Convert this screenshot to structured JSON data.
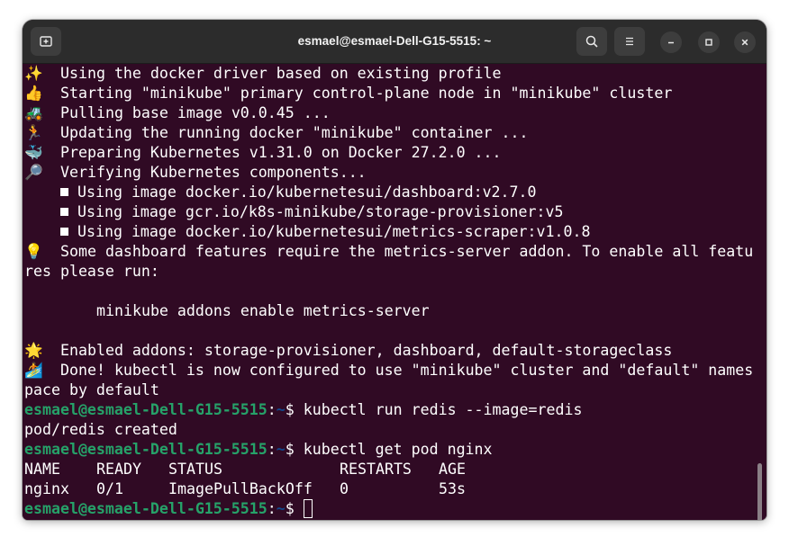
{
  "window": {
    "title": "esmael@esmael-Dell-G15-5515: ~",
    "new_tab_icon": "new-tab-icon",
    "search_icon": "search-icon",
    "menu_icon": "hamburger-menu-icon",
    "minimize_icon": "minimize-icon",
    "maximize_icon": "maximize-icon",
    "close_icon": "close-icon"
  },
  "terminal": {
    "colors": {
      "background": "#300a24",
      "prompt_user": "#26a269",
      "prompt_path": "#12488b",
      "text": "#ffffff"
    },
    "lines": [
      {
        "emoji": "✨",
        "text": "Using the docker driver based on existing profile"
      },
      {
        "emoji": "👍",
        "text": "Starting \"minikube\" primary control-plane node in \"minikube\" cluster"
      },
      {
        "emoji": "🚜",
        "text": "Pulling base image v0.0.45 ..."
      },
      {
        "emoji": "🏃",
        "text": "Updating the running docker \"minikube\" container ..."
      },
      {
        "emoji": "🐳",
        "text": "Preparing Kubernetes v1.31.0 on Docker 27.2.0 ..."
      },
      {
        "emoji": "🔎",
        "text": "Verifying Kubernetes components..."
      }
    ],
    "bullets": [
      "Using image docker.io/kubernetesui/dashboard:v2.7.0",
      "Using image gcr.io/k8s-minikube/storage-provisioner:v5",
      "Using image docker.io/kubernetesui/metrics-scraper:v1.0.8"
    ],
    "tip": {
      "emoji": "💡",
      "text": "Some dashboard features require the metrics-server addon. To enable all featu",
      "wrap": "res please run:"
    },
    "tip_command": "minikube addons enable metrics-server",
    "addons": {
      "emoji": "🌟",
      "text": "Enabled addons: storage-provisioner, dashboard, default-storageclass"
    },
    "done": {
      "emoji": "🏄",
      "text": "Done! kubectl is now configured to use \"minikube\" cluster and \"default\" names",
      "wrap": "pace by default"
    },
    "prompt_user_host": "esmael@esmael-Dell-G15-5515",
    "prompt_sep": ":",
    "prompt_path": "~",
    "prompt_symbol": "$ ",
    "cmd1": "kubectl run redis --image=redis",
    "cmd1_output": "pod/redis created",
    "cmd2": "kubectl get pod nginx",
    "table": {
      "headers": [
        "NAME",
        "READY",
        "STATUS",
        "RESTARTS",
        "AGE"
      ],
      "rows": [
        [
          "nginx",
          "0/1",
          "ImagePullBackOff",
          "0",
          "53s"
        ]
      ]
    }
  }
}
